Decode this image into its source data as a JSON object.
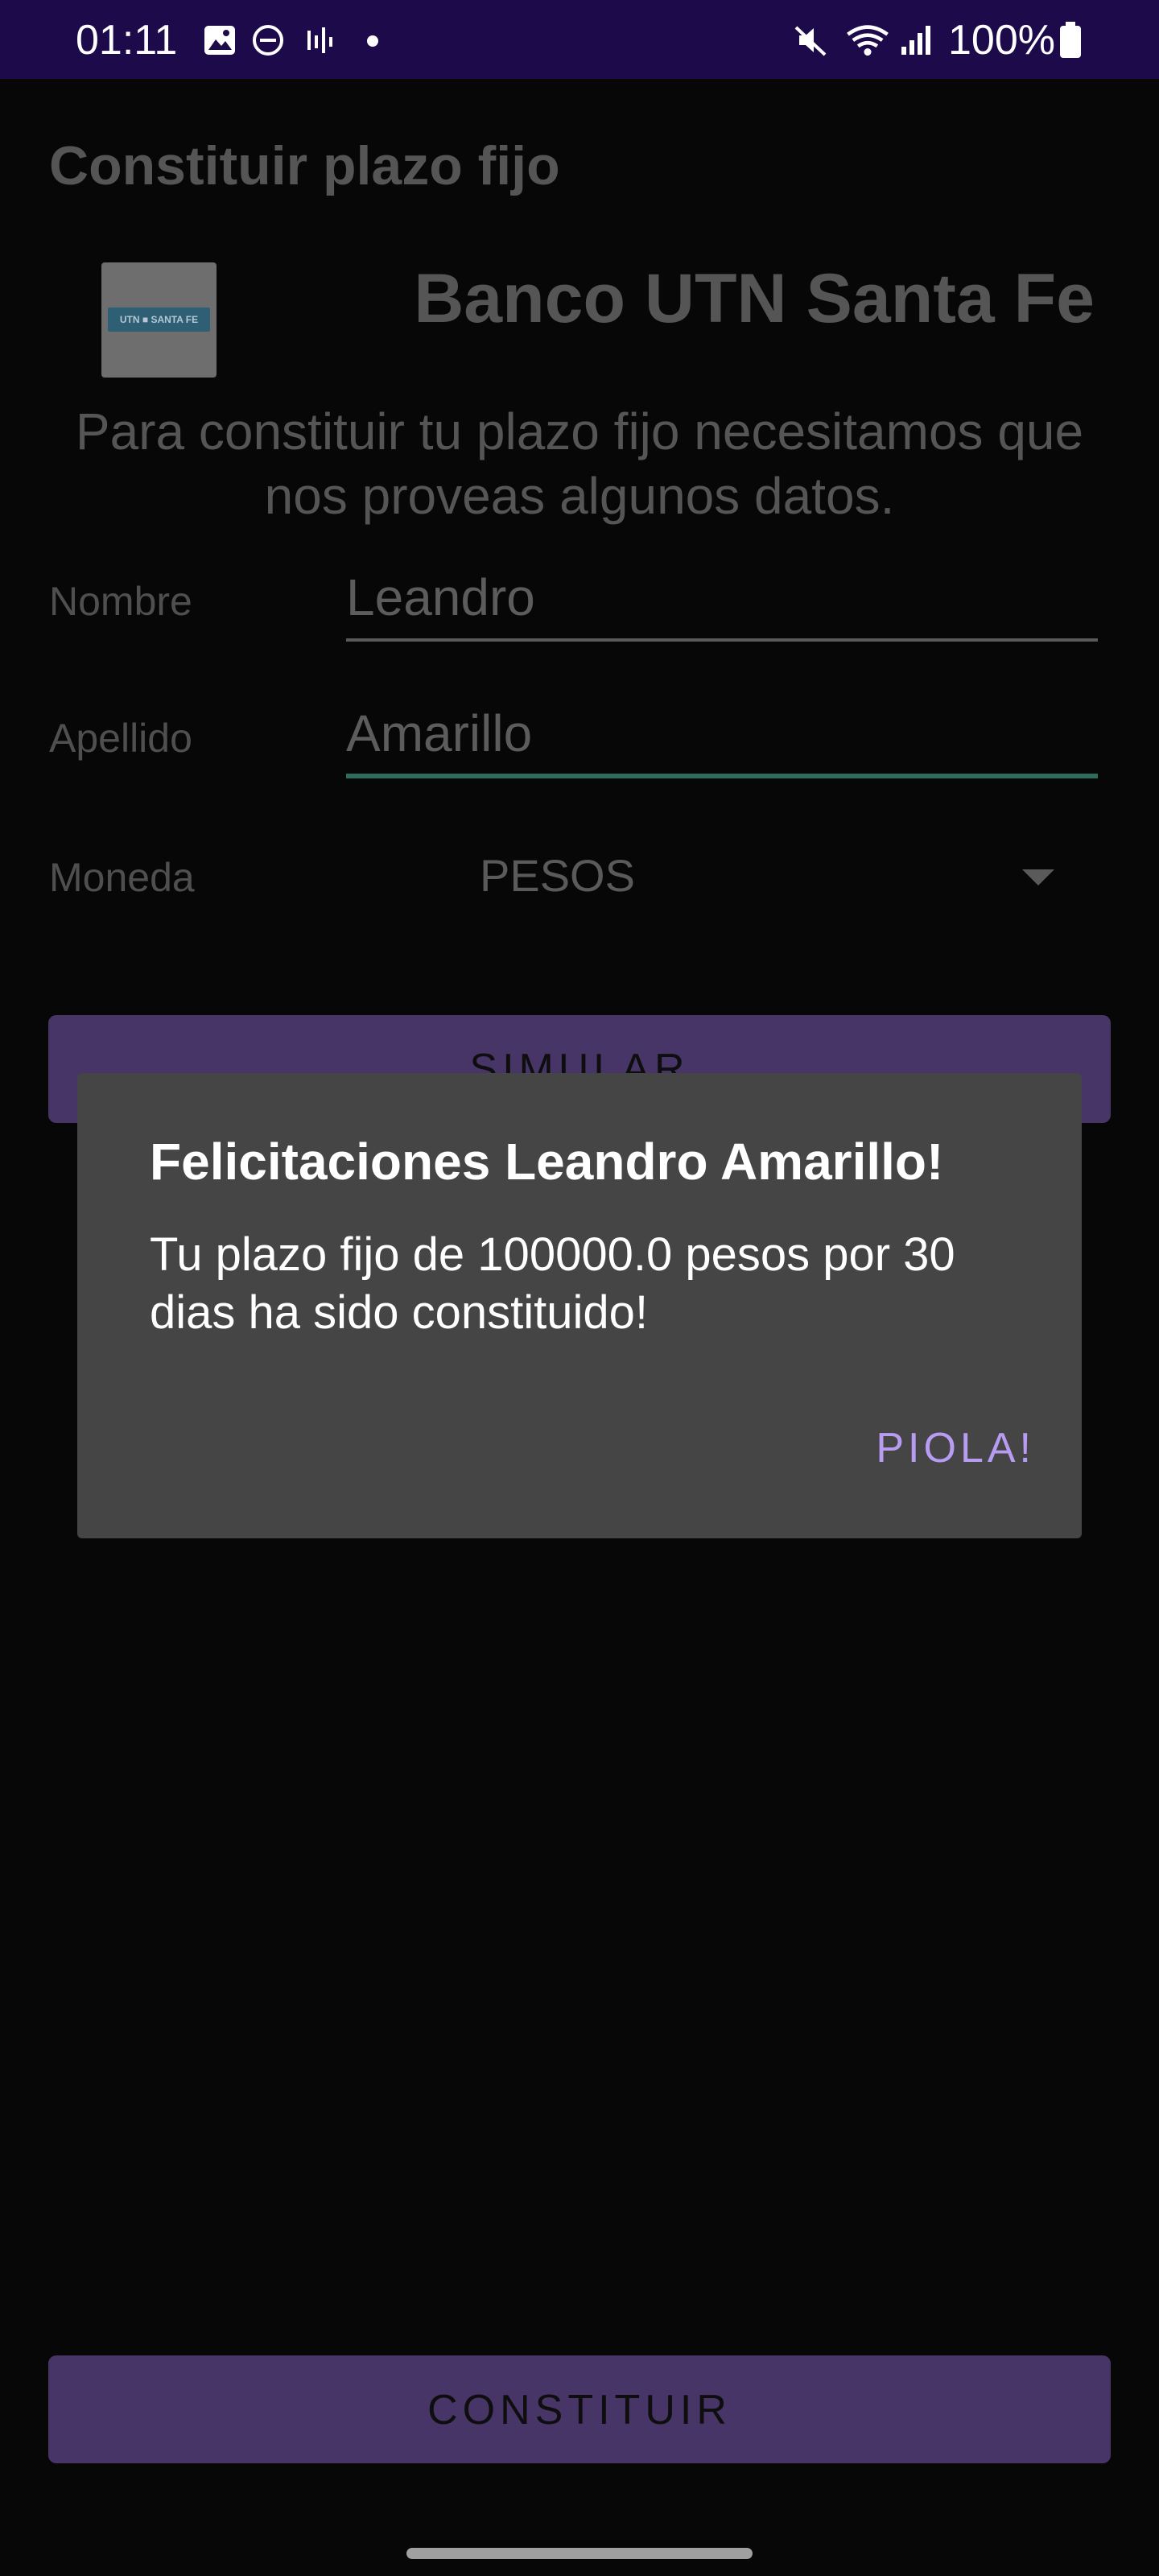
{
  "status_bar": {
    "time": "01:11",
    "battery_text": "100%",
    "left_icons": [
      "image-icon",
      "do-not-disturb-icon",
      "activity-icon",
      "notification-dot-icon"
    ],
    "right_icons": [
      "mute-icon",
      "wifi-icon",
      "signal-icon",
      "battery-icon"
    ]
  },
  "app": {
    "title": "Constituir plazo fijo",
    "bank_name": "Banco UTN Santa Fe",
    "logo_text": "UTN ■ SANTA FE",
    "intro": "Para constituir tu plazo fijo necesitamos que nos proveas algunos datos.",
    "form": {
      "nombre_label": "Nombre",
      "nombre_value": "Leandro",
      "apellido_label": "Apellido",
      "apellido_value": "Amarillo",
      "moneda_label": "Moneda",
      "moneda_value": "PESOS"
    },
    "simular_label": "SIMULAR",
    "constituir_label": "CONSTITUIR"
  },
  "dialog": {
    "title": "Felicitaciones Leandro Amarillo!",
    "message": "Tu plazo fijo de 100000.0 pesos por 30 dias ha sido constituido!",
    "button_label": "PIOLA!"
  },
  "colors": {
    "status_bar_bg": "#1c0a4a",
    "background": "#070707",
    "button_purple": "#483568",
    "dialog_bg": "#454545",
    "dialog_accent": "#b79cf2",
    "focus_underline": "#2e6c5c"
  }
}
